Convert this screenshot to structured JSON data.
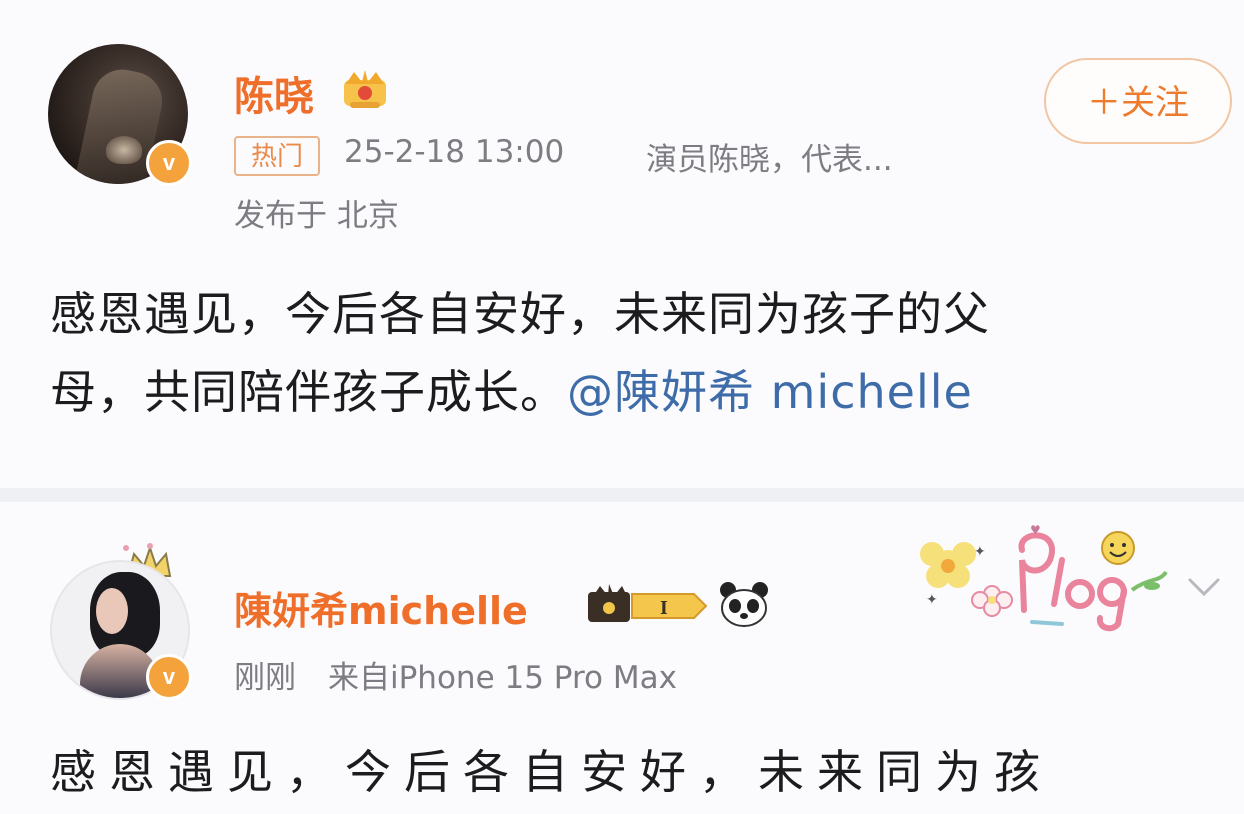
{
  "post1": {
    "author": "陈晓",
    "follow_label": "＋关注",
    "hot_tag": "热门",
    "timestamp": "25-2-18 13:00",
    "bio": "演员陈晓，代表...",
    "location": "发布于 北京",
    "content_line1": "感恩遇见，今后各自安好，未来同为孩子的父",
    "content_line2": "母，共同陪伴孩子成长。",
    "mention": "@陳妍希 michelle"
  },
  "post2": {
    "author": "陳妍希michelle",
    "level_badge": "I",
    "time_ago": "刚刚",
    "source": "来自iPhone 15 Pro Max",
    "content_line1": "感恩遇见，今后各自安好，未来同为孩"
  },
  "colors": {
    "name_orange": "#ee6e2a",
    "mention_blue": "#3e6ca8",
    "verified_badge": "#f4a23b",
    "meta_gray": "#7c7c82"
  },
  "icons": {
    "verified": "verified-v-icon",
    "vip_crown": "crown-icon",
    "panda": "panda-icon",
    "more": "chevron-down-icon",
    "sticker": "plog-sticker"
  }
}
